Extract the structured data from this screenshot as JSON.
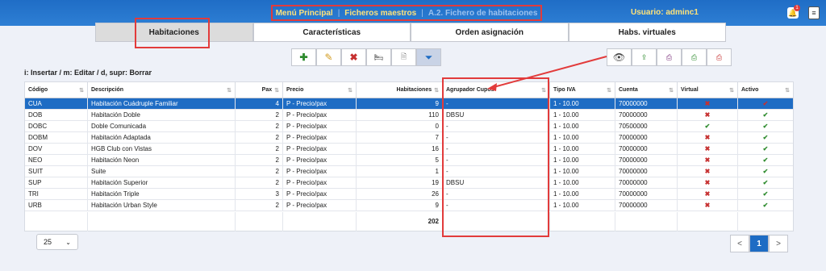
{
  "topbar": {
    "menu": "Menú Principal",
    "masters": "Ficheros maestros",
    "current": "A.2. Fichero de habitaciones",
    "user": "Usuario: adminc1",
    "bell_count": "1"
  },
  "tabs": [
    "Habitaciones",
    "Características",
    "Orden asignación",
    "Habs. virtuales"
  ],
  "hint": "i: Insertar / m: Editar / d, supr: Borrar",
  "columns": {
    "codigo": "Código",
    "descripcion": "Descripción",
    "pax": "Pax",
    "precio": "Precio",
    "habitaciones": "Habitaciones",
    "agrupador": "Agrupador Cupos",
    "iva": "Tipo IVA",
    "cuenta": "Cuenta",
    "virtual": "Virtual",
    "activo": "Activo"
  },
  "rows": [
    {
      "codigo": "CUA",
      "descripcion": "Habitación Cuádruple Familiar",
      "pax": "4",
      "precio": "P - Precio/pax",
      "habitaciones": "9",
      "agrupador": "-",
      "iva": "1 - 10.00",
      "cuenta": "70000000",
      "virtual": "✖",
      "activo": "✔"
    },
    {
      "codigo": "DOB",
      "descripcion": "Habitación Doble",
      "pax": "2",
      "precio": "P - Precio/pax",
      "habitaciones": "110",
      "agrupador": "DBSU",
      "iva": "1 - 10.00",
      "cuenta": "70000000",
      "virtual": "✖",
      "activo": "✔"
    },
    {
      "codigo": "DOBC",
      "descripcion": "Doble Comunicada",
      "pax": "2",
      "precio": "P - Precio/pax",
      "habitaciones": "0",
      "agrupador": "-",
      "iva": "1 - 10.00",
      "cuenta": "70500000",
      "virtual": "✔",
      "activo": "✔"
    },
    {
      "codigo": "DOBM",
      "descripcion": "Habitación Adaptada",
      "pax": "2",
      "precio": "P - Precio/pax",
      "habitaciones": "7",
      "agrupador": "-",
      "iva": "1 - 10.00",
      "cuenta": "70000000",
      "virtual": "✖",
      "activo": "✔"
    },
    {
      "codigo": "DOV",
      "descripcion": "HGB Club con Vistas",
      "pax": "2",
      "precio": "P - Precio/pax",
      "habitaciones": "16",
      "agrupador": "-",
      "iva": "1 - 10.00",
      "cuenta": "70000000",
      "virtual": "✖",
      "activo": "✔"
    },
    {
      "codigo": "NEO",
      "descripcion": "Habitación Neon",
      "pax": "2",
      "precio": "P - Precio/pax",
      "habitaciones": "5",
      "agrupador": "-",
      "iva": "1 - 10.00",
      "cuenta": "70000000",
      "virtual": "✖",
      "activo": "✔"
    },
    {
      "codigo": "SUIT",
      "descripcion": "Suite",
      "pax": "2",
      "precio": "P - Precio/pax",
      "habitaciones": "1",
      "agrupador": "-",
      "iva": "1 - 10.00",
      "cuenta": "70000000",
      "virtual": "✖",
      "activo": "✔"
    },
    {
      "codigo": "SUP",
      "descripcion": "Habitación Superior",
      "pax": "2",
      "precio": "P - Precio/pax",
      "habitaciones": "19",
      "agrupador": "DBSU",
      "iva": "1 - 10.00",
      "cuenta": "70000000",
      "virtual": "✖",
      "activo": "✔"
    },
    {
      "codigo": "TRI",
      "descripcion": "Habitación Triple",
      "pax": "3",
      "precio": "P - Precio/pax",
      "habitaciones": "26",
      "agrupador": "-",
      "iva": "1 - 10.00",
      "cuenta": "70000000",
      "virtual": "✖",
      "activo": "✔"
    },
    {
      "codigo": "URB",
      "descripcion": "Habitación Urban Style",
      "pax": "2",
      "precio": "P - Precio/pax",
      "habitaciones": "9",
      "agrupador": "-",
      "iva": "1 - 10.00",
      "cuenta": "70000000",
      "virtual": "✖",
      "activo": "✔"
    }
  ],
  "total_habitaciones": "202",
  "pagesize": "25",
  "pager": {
    "prev": "<",
    "page": "1",
    "next": ">"
  },
  "icons": {
    "add": "plus-icon",
    "edit": "pencil-icon",
    "delete": "x-icon",
    "bed": "bed-icon",
    "doc": "document-icon",
    "filter": "filter-icon",
    "view": "eye-icon",
    "export": "export-icon",
    "print": "printer-icon",
    "print2": "printer-icon",
    "pdf": "pdf-icon"
  },
  "colors": {
    "topbar": "#1f6dc6",
    "highlight": "#e23b3b",
    "selected_row": "#1e6cc4",
    "check": "#2f8c2f",
    "cross": "#c63030"
  }
}
